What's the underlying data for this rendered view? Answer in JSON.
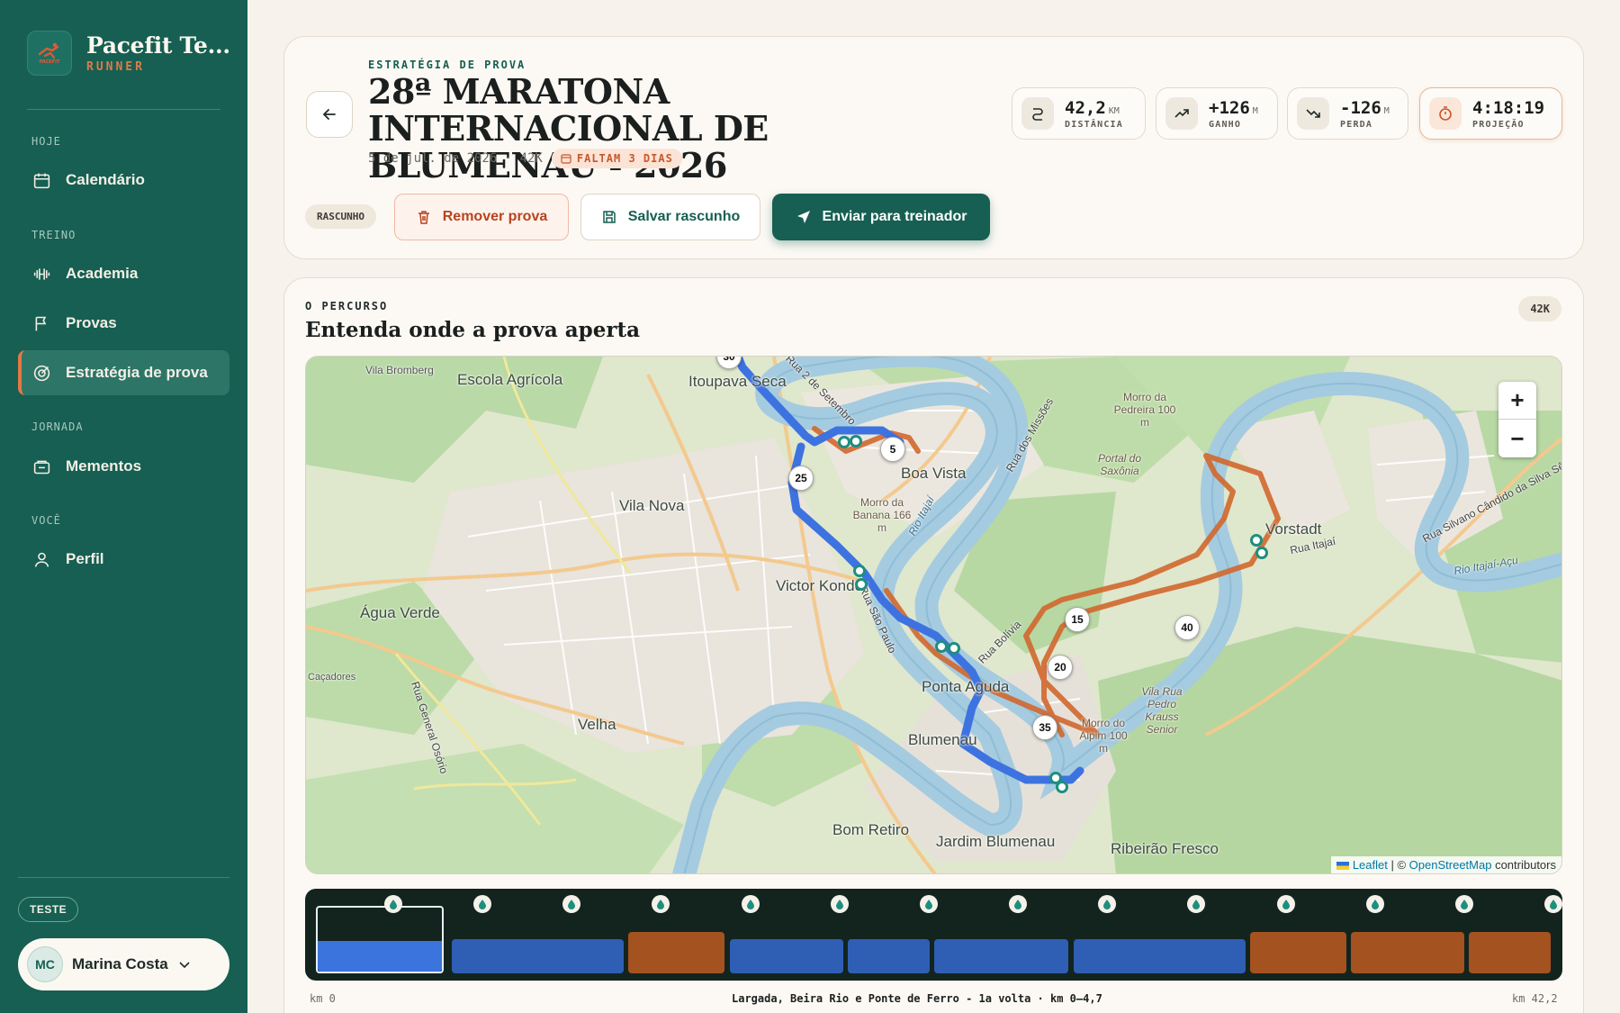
{
  "brand": {
    "name": "Pacefit Te...",
    "sub": "RUNNER",
    "logo_text": "PACEFIT"
  },
  "sidebar": {
    "sections": [
      {
        "label": "HOJE"
      },
      {
        "label": "TREINO"
      },
      {
        "label": "JORNADA"
      },
      {
        "label": "VOCÊ"
      }
    ],
    "items": [
      {
        "label": "Calendário",
        "icon": "calendar-icon"
      },
      {
        "label": "Academia",
        "icon": "dumbbell-icon"
      },
      {
        "label": "Provas",
        "icon": "flag-icon"
      },
      {
        "label": "Estratégia de prova",
        "icon": "target-icon",
        "active": true
      },
      {
        "label": "Mementos",
        "icon": "photo-icon"
      },
      {
        "label": "Perfil",
        "icon": "user-icon"
      }
    ],
    "env_badge": "TESTE",
    "user": {
      "initials": "MC",
      "name": "Marina Costa"
    }
  },
  "header": {
    "eyebrow": "ESTRATÉGIA DE PROVA",
    "title": "28ª MARATONA INTERNACIONAL DE BLUMENAU - 2026",
    "date": "5 de jul. de 2026 · 42K",
    "countdown": "FALTAM 3 DIAS",
    "stats": [
      {
        "value": "42,2",
        "unit": "KM",
        "label": "DISTÂNCIA",
        "icon": "route-icon"
      },
      {
        "value": "+126",
        "unit": "M",
        "label": "GANHO",
        "icon": "trend-up-icon"
      },
      {
        "value": "-126",
        "unit": "M",
        "label": "PERDA",
        "icon": "trend-down-icon"
      },
      {
        "value": "4:18:19",
        "unit": "",
        "label": "PROJEÇÃO",
        "icon": "stopwatch-icon"
      }
    ],
    "status_badge": "RASCUNHO",
    "buttons": {
      "remove": "Remover prova",
      "save": "Salvar rascunho",
      "send": "Enviar para treinador"
    }
  },
  "course": {
    "eyebrow": "O PERCURSO",
    "title": "Entenda onde a prova aperta",
    "distance_pill": "42K",
    "map": {
      "labels": [
        "Vila Bromberg",
        "Escola Agrícola",
        "Itoupava Seca",
        "Boa Vista",
        "Vila Nova",
        "Victor Konder",
        "Água Verde",
        "Velha",
        "Ponta Aguda",
        "Blumenau",
        "Bom Retiro",
        "Jardim Blumenau",
        "Ribeirão Fresco",
        "Vorstadt",
        "Caçadores",
        "Morro da Pedreira 100 m",
        "Portal do Saxônia",
        "Morro da Banana 166 m",
        "Vila Rua Pedro Krauss Senior",
        "Morro do Aipim 100 m",
        "Rio Itajaí-Açu",
        "Rua Itajaí",
        "Rua Silvano Cândido da Silva Sênior",
        "Rua General Osório",
        "Rua São Paulo",
        "Rua dos Missões",
        "Rio Itajaí",
        "Rua 2 de Setembro",
        "Rua Bolívia"
      ],
      "km_markers": [
        "30",
        "5",
        "25",
        "15",
        "40",
        "20",
        "35"
      ],
      "zoom_in": "+",
      "zoom_out": "−",
      "attribution_leaflet": "Leaflet",
      "attribution_sep": " | © ",
      "attribution_osm": "OpenStreetMap",
      "attribution_rest": " contributors"
    },
    "strip": {
      "start": "km 0",
      "segment_caption": "Largada, Beira Rio e Ponte de Ferro - 1a volta · km 0–4,7",
      "end": "km 42,2",
      "aid_station_count": 14
    },
    "colors": {
      "fast_segment": "#2e5fb4",
      "slow_segment": "#a4521f",
      "route_blue": "#3d73e0",
      "route_orange": "#d2672e"
    }
  }
}
